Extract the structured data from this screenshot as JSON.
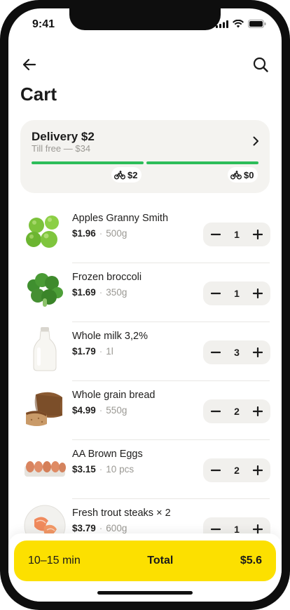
{
  "status_bar": {
    "time": "9:41"
  },
  "header": {
    "title": "Cart"
  },
  "delivery": {
    "title": "Delivery $2",
    "subtitle": "Till free — $34",
    "tiers": [
      {
        "price": "$2"
      },
      {
        "price": "$0"
      }
    ],
    "progress_color": "#2dbd5a"
  },
  "items": [
    {
      "name": "Apples Granny Smith",
      "price": "$1.96",
      "unit": "500g",
      "qty": "1",
      "icon": "apples"
    },
    {
      "name": "Frozen broccoli",
      "price": "$1.69",
      "unit": "350g",
      "qty": "1",
      "icon": "broccoli"
    },
    {
      "name": "Whole milk 3,2%",
      "price": "$1.79",
      "unit": "1l",
      "qty": "3",
      "icon": "milk-bottle"
    },
    {
      "name": "Whole grain bread",
      "price": "$4.99",
      "unit": "550g",
      "qty": "2",
      "icon": "bread"
    },
    {
      "name": "AA Brown Eggs",
      "price": "$3.15",
      "unit": "10 pcs",
      "qty": "2",
      "icon": "eggs"
    },
    {
      "name": "Fresh trout steaks × 2",
      "price": "$3.79",
      "unit": "600g",
      "qty": "1",
      "icon": "trout"
    }
  ],
  "checkout": {
    "eta": "10–15 min",
    "total_label": "Total",
    "total_value": "$5.6",
    "accent": "#fce000"
  }
}
